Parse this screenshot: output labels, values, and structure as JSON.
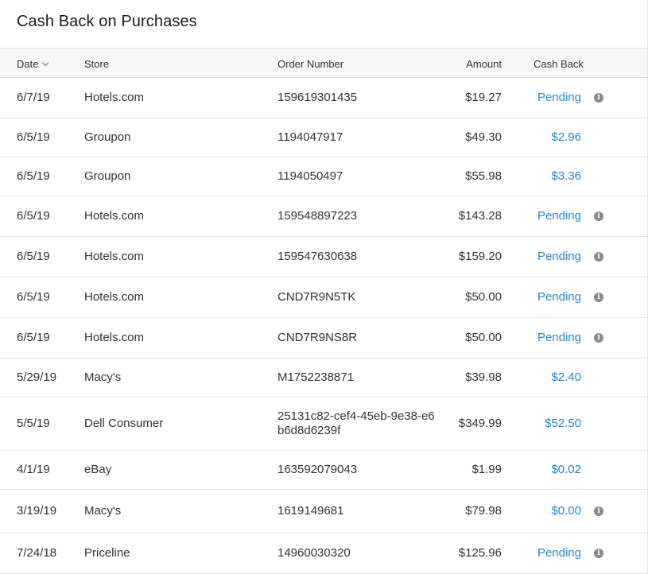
{
  "page": {
    "title": "Cash Back on Purchases"
  },
  "columns": {
    "date": "Date",
    "store": "Store",
    "order": "Order Number",
    "amount": "Amount",
    "cashback": "Cash Back"
  },
  "colors": {
    "link": "#2a86c8",
    "text": "#333333",
    "header_bg": "#f7f7f7"
  },
  "rows": [
    {
      "date": "6/7/19",
      "store": "Hotels.com",
      "order": "159619301435",
      "amount": "$19.27",
      "cashback": "Pending",
      "info": true
    },
    {
      "date": "6/5/19",
      "store": "Groupon",
      "order": "1194047917",
      "amount": "$49.30",
      "cashback": "$2.96",
      "info": false
    },
    {
      "date": "6/5/19",
      "store": "Groupon",
      "order": "1194050497",
      "amount": "$55.98",
      "cashback": "$3.36",
      "info": false
    },
    {
      "date": "6/5/19",
      "store": "Hotels.com",
      "order": "159548897223",
      "amount": "$143.28",
      "cashback": "Pending",
      "info": true
    },
    {
      "date": "6/5/19",
      "store": "Hotels.com",
      "order": "159547630638",
      "amount": "$159.20",
      "cashback": "Pending",
      "info": true
    },
    {
      "date": "6/5/19",
      "store": "Hotels.com",
      "order": "CND7R9N5TK",
      "amount": "$50.00",
      "cashback": "Pending",
      "info": true
    },
    {
      "date": "6/5/19",
      "store": "Hotels.com",
      "order": "CND7R9NS8R",
      "amount": "$50.00",
      "cashback": "Pending",
      "info": true
    },
    {
      "date": "5/29/19",
      "store": "Macy's",
      "order": "M1752238871",
      "amount": "$39.98",
      "cashback": "$2.40",
      "info": false
    },
    {
      "date": "5/5/19",
      "store": "Dell Consumer",
      "order": "25131c82-cef4-45eb-9e38-e6b6d8d6239f",
      "amount": "$349.99",
      "cashback": "$52.50",
      "info": false
    },
    {
      "date": "4/1/19",
      "store": "eBay",
      "order": "163592079043",
      "amount": "$1.99",
      "cashback": "$0.02",
      "info": false
    },
    {
      "date": "3/19/19",
      "store": "Macy's",
      "order": "1619149681",
      "amount": "$79.98",
      "cashback": "$0.00",
      "info": true
    },
    {
      "date": "7/24/18",
      "store": "Priceline",
      "order": "14960030320",
      "amount": "$125.96",
      "cashback": "Pending",
      "info": true
    }
  ]
}
